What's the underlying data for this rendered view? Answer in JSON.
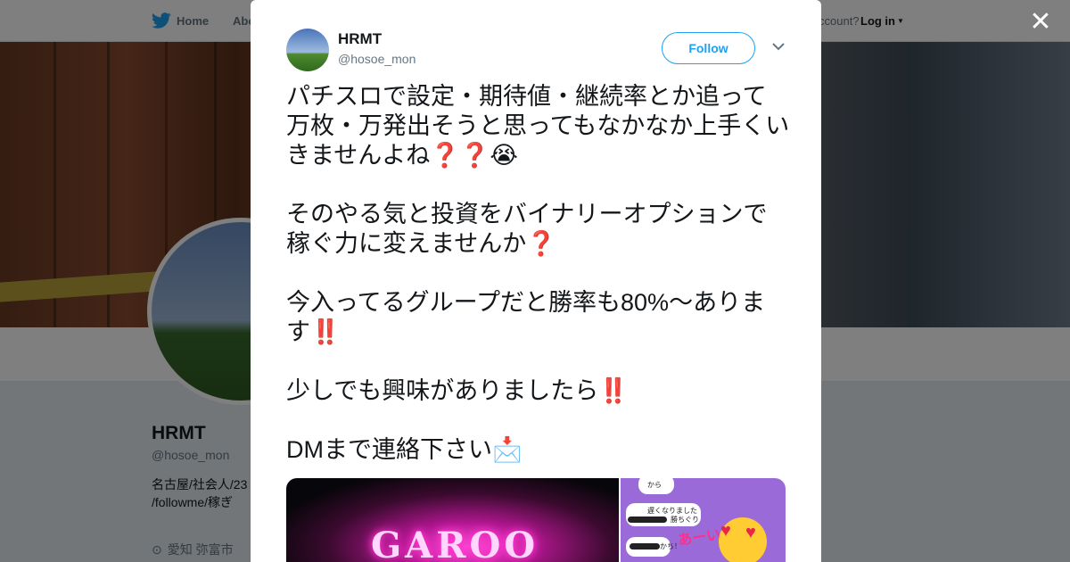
{
  "nav": {
    "home_label": "Home",
    "about_label": "Abo",
    "account_text": "ccount?",
    "login_label": "Log in"
  },
  "profile": {
    "name": "HRMT",
    "handle": "@hosoe_mon",
    "bio_line1": "名古屋/社会人/23",
    "bio_line2": "/followme/稼ぎ",
    "location": "愛知 弥富市"
  },
  "tweet": {
    "name": "HRMT",
    "handle": "@hosoe_mon",
    "follow_label": "Follow",
    "paragraphs": [
      "パチスロで設定・期待値・継続率とか追って万枚・万発出そうと思ってもなかなか上手くいきませんよね❓❓😭",
      "そのやる気と投資をバイナリーオプションで稼ぐ力に変えませんか❓",
      "今入ってるグループだと勝率も80%〜あります‼️",
      "少しでも興味がありましたら‼️",
      "DMまで連絡下さい📩"
    ],
    "media": {
      "sign_text": "GAROO",
      "chat_from": "から",
      "chat_line1": "遅くなりました",
      "chat_line1b": "勝ちぐり",
      "chat_line2": "かち！",
      "chat_exclaim": "あーい!!"
    }
  },
  "colors": {
    "twitter_blue": "#1da1f2",
    "text_primary": "#14171a",
    "text_secondary": "#657786"
  },
  "icons": [
    "twitter-bird-icon",
    "close-icon",
    "chevron-down-icon",
    "location-pin-icon"
  ]
}
